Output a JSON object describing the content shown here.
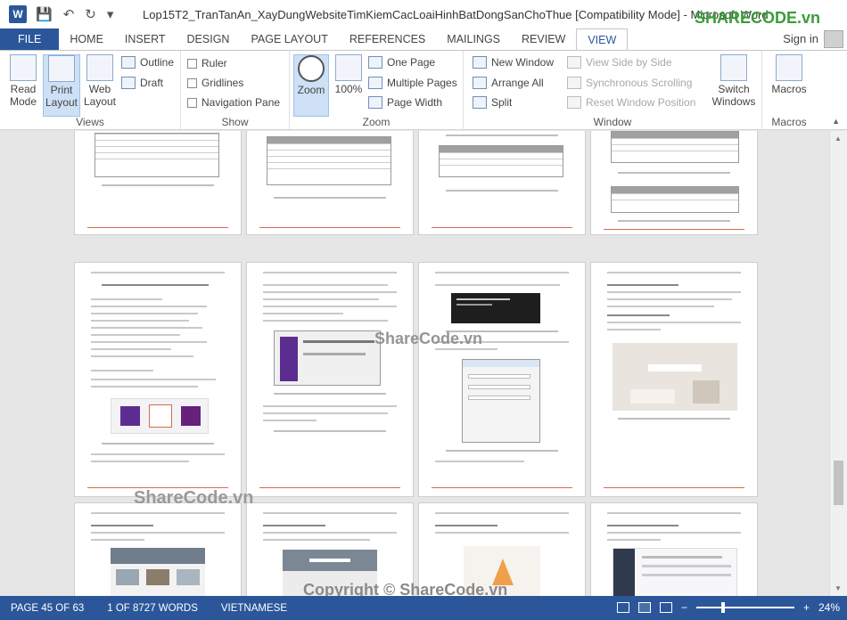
{
  "window": {
    "app_icon": "W",
    "title": "Lop15T2_TranTanAn_XayDungWebsiteTimKiemCacLoaiHinhBatDongSanChoThue [Compatibility Mode] - Microsoft Word",
    "logo_text": "SHARECODE.vn"
  },
  "tabs": [
    "FILE",
    "HOME",
    "INSERT",
    "DESIGN",
    "PAGE LAYOUT",
    "REFERENCES",
    "MAILINGS",
    "REVIEW",
    "VIEW"
  ],
  "account": {
    "signin": "Sign in"
  },
  "ribbon": {
    "views": {
      "label": "Views",
      "read_mode": "Read Mode",
      "print_layout": "Print Layout",
      "web_layout": "Web Layout",
      "outline": "Outline",
      "draft": "Draft"
    },
    "show": {
      "label": "Show",
      "ruler": "Ruler",
      "gridlines": "Gridlines",
      "navigation_pane": "Navigation Pane"
    },
    "zoom": {
      "label": "Zoom",
      "zoom": "Zoom",
      "hundred": "100%",
      "one_page": "One Page",
      "multiple_pages": "Multiple Pages",
      "page_width": "Page Width"
    },
    "window": {
      "label": "Window",
      "new_window": "New Window",
      "arrange_all": "Arrange All",
      "split": "Split",
      "view_side_by_side": "View Side by Side",
      "synchronous_scrolling": "Synchronous Scrolling",
      "reset_window_position": "Reset Window Position",
      "switch_windows": "Switch Windows"
    },
    "macros": {
      "label": "Macros",
      "macros": "Macros"
    }
  },
  "watermarks": {
    "center": "ShareCode.vn",
    "left": "ShareCode.vn",
    "bottom": "Copyright © ShareCode.vn"
  },
  "status": {
    "page": "PAGE 45 OF 63",
    "words": "1 OF 8727 WORDS",
    "language": "VIETNAMESE",
    "zoom": "24%"
  },
  "colors": {
    "word_blue": "#2b579a",
    "accent_orange": "#f39200",
    "logo_green": "#3a9d3a"
  }
}
